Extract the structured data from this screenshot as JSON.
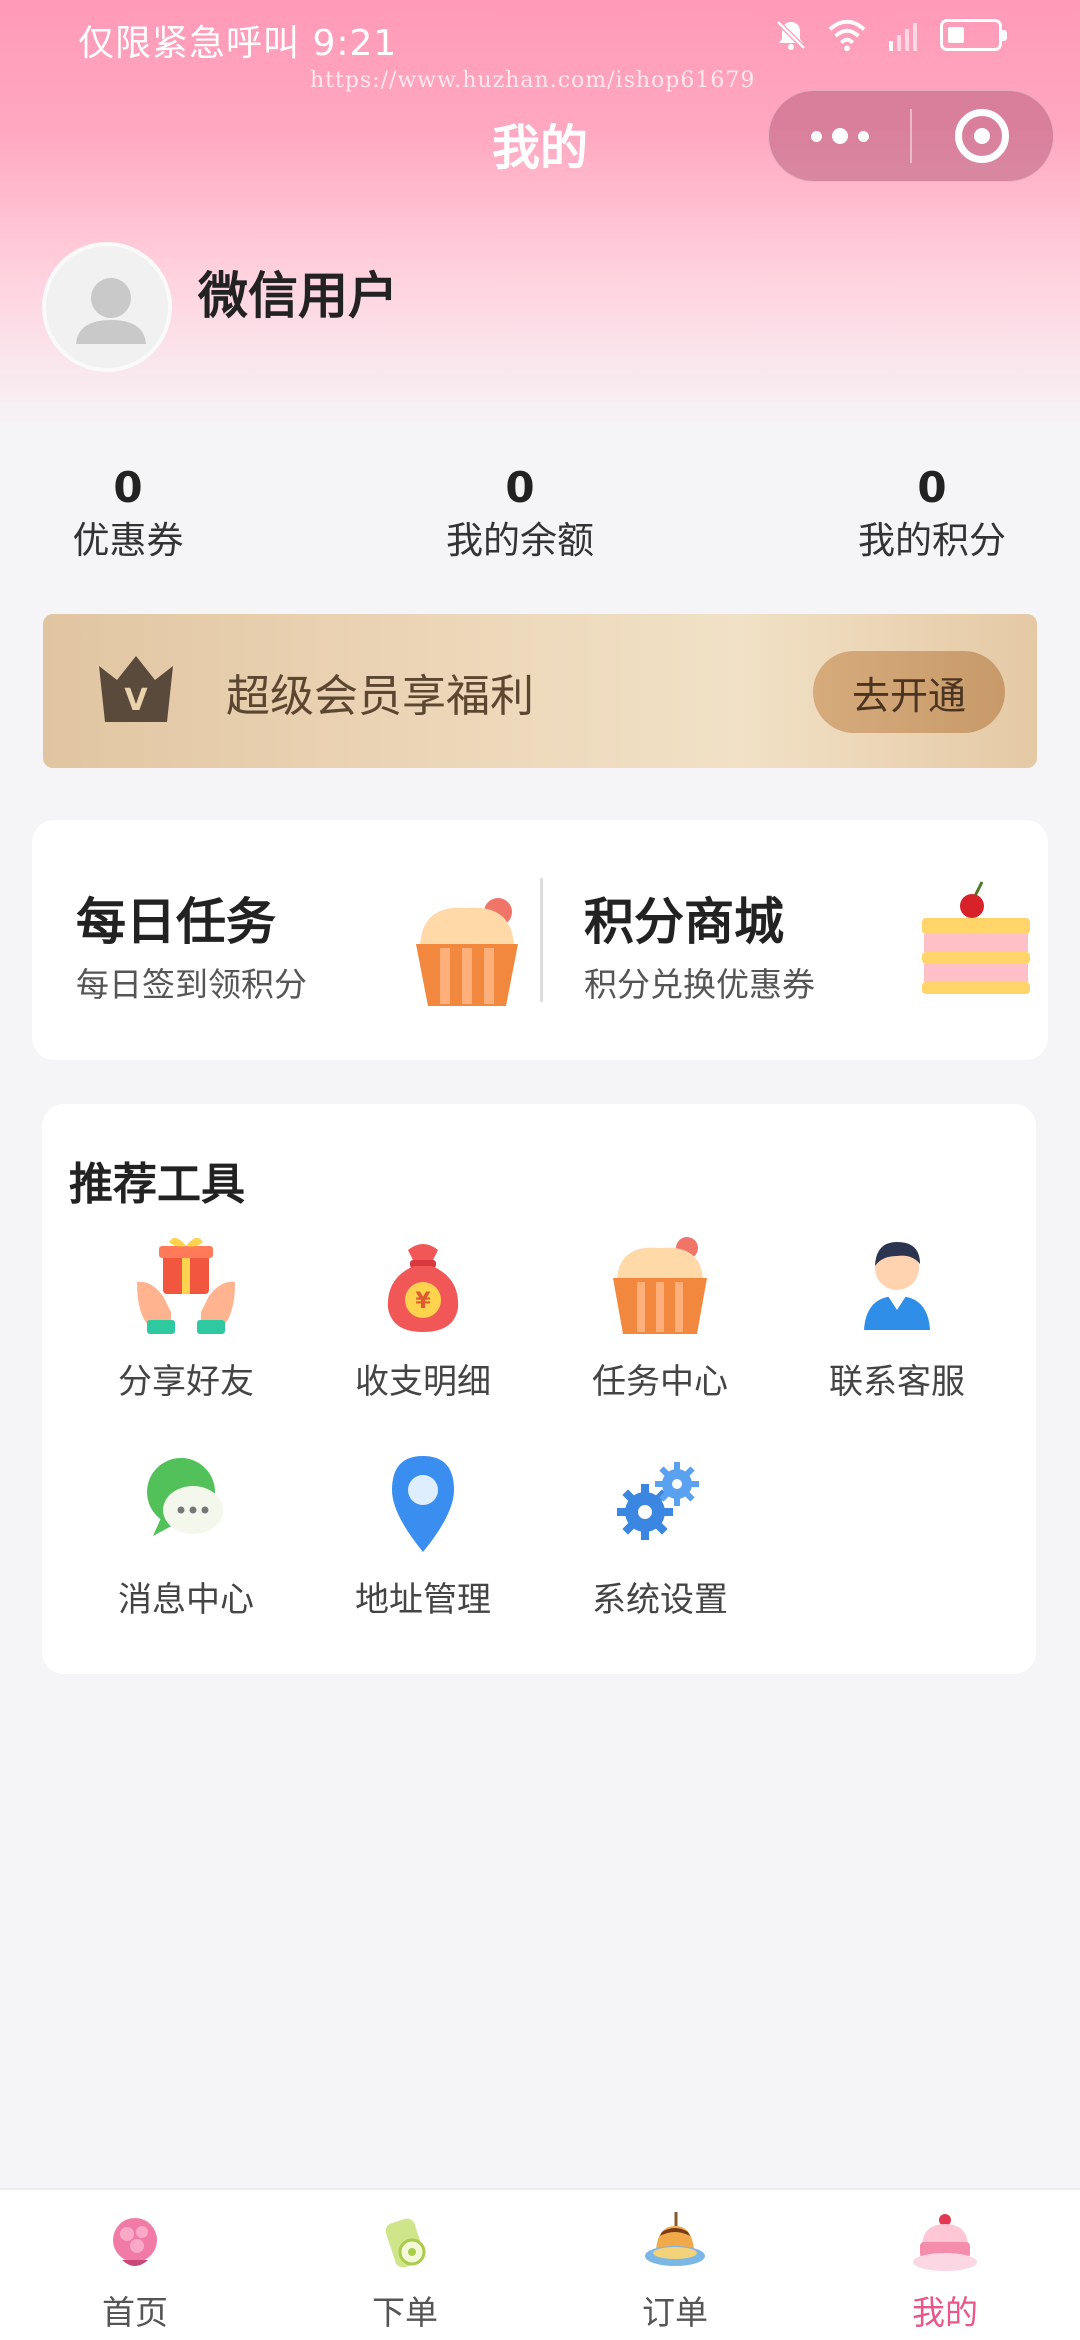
{
  "status_bar": {
    "carrier_time": "仅限紧急呼叫 9:21"
  },
  "watermark": "https://www.huzhan.com/ishop61679",
  "navbar": {
    "title": "我的"
  },
  "user": {
    "nickname": "微信用户"
  },
  "stats": [
    {
      "value": "0",
      "label": "优惠券"
    },
    {
      "value": "0",
      "label": "我的余额"
    },
    {
      "value": "0",
      "label": "我的积分"
    }
  ],
  "vip": {
    "crown_letter": "V",
    "text": "超级会员享福利",
    "button": "去开通"
  },
  "tasks": [
    {
      "title": "每日任务",
      "subtitle": "每日签到领积分",
      "icon": "cupcake-icon"
    },
    {
      "title": "积分商城",
      "subtitle": "积分兑换优惠券",
      "icon": "layer-cake-icon"
    }
  ],
  "tools": {
    "title": "推荐工具",
    "items": [
      {
        "label": "分享好友",
        "icon": "gift-hands-icon"
      },
      {
        "label": "收支明细",
        "icon": "money-bag-icon"
      },
      {
        "label": "任务中心",
        "icon": "cupcake-icon"
      },
      {
        "label": "联系客服",
        "icon": "customer-service-icon"
      },
      {
        "label": "消息中心",
        "icon": "message-bubble-icon"
      },
      {
        "label": "地址管理",
        "icon": "location-pin-icon"
      },
      {
        "label": "系统设置",
        "icon": "gears-icon"
      }
    ]
  },
  "tabbar": {
    "items": [
      {
        "label": "首页",
        "icon": "home-flower-icon",
        "active": false
      },
      {
        "label": "下单",
        "icon": "order-drink-icon",
        "active": false
      },
      {
        "label": "订单",
        "icon": "pudding-icon",
        "active": false
      },
      {
        "label": "我的",
        "icon": "cake-profile-icon",
        "active": true
      }
    ],
    "active_color": "#e9568a"
  },
  "colors": {
    "header_pink": "#ff9ab8",
    "vip_gold": "#e1c5a1",
    "page_bg": "#f5f5f7"
  }
}
